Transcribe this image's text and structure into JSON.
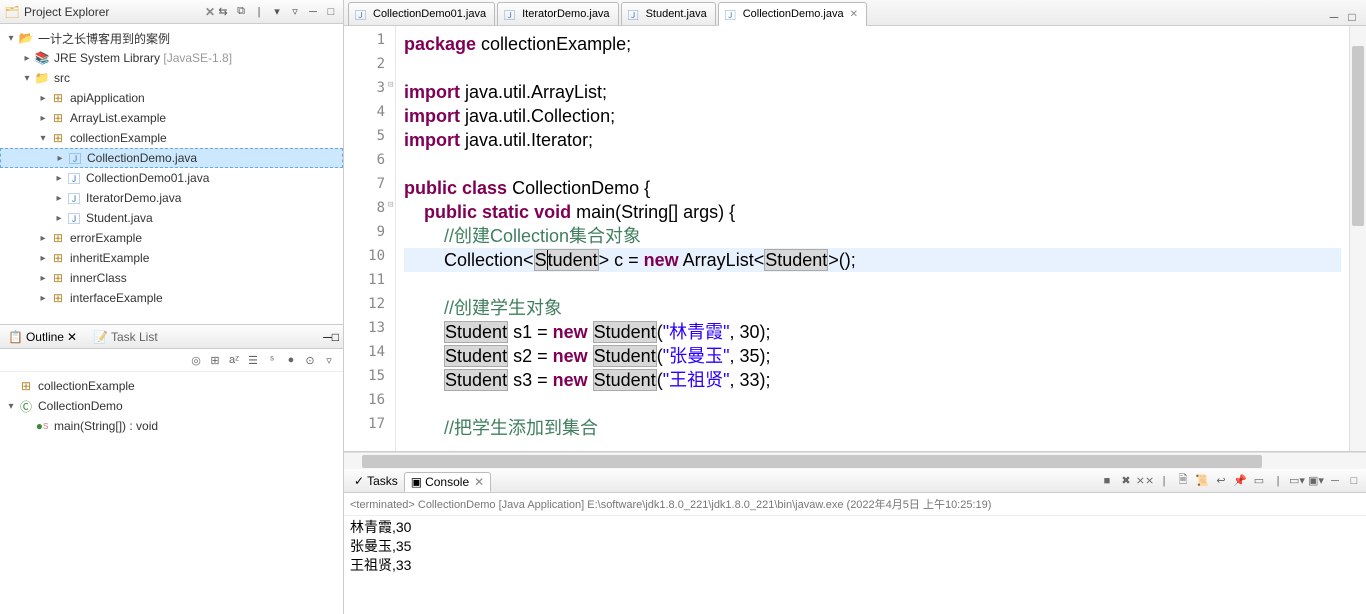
{
  "explorer": {
    "title": "Project Explorer",
    "items": [
      {
        "indent": 0,
        "arrow": "▾",
        "icon": "📂",
        "label": "一计之长博客用到的案例",
        "iconClass": "ic-folder",
        "expanded": true
      },
      {
        "indent": 1,
        "arrow": "▸",
        "icon": "📚",
        "label": "JRE System Library ",
        "suffix": "[JavaSE-1.8]",
        "iconClass": "ic-lib"
      },
      {
        "indent": 1,
        "arrow": "▾",
        "icon": "📁",
        "label": "src",
        "iconClass": "ic-pkg",
        "expanded": true
      },
      {
        "indent": 2,
        "arrow": "▸",
        "icon": "⊞",
        "label": "apiApplication",
        "iconClass": "ic-pkg"
      },
      {
        "indent": 2,
        "arrow": "▸",
        "icon": "⊞",
        "label": "ArrayList.example",
        "iconClass": "ic-pkg"
      },
      {
        "indent": 2,
        "arrow": "▾",
        "icon": "⊞",
        "label": "collectionExample",
        "iconClass": "ic-pkg",
        "expanded": true
      },
      {
        "indent": 3,
        "arrow": "▸",
        "icon": "🄹",
        "label": "CollectionDemo.java",
        "iconClass": "ic-java",
        "selected": true
      },
      {
        "indent": 3,
        "arrow": "▸",
        "icon": "🄹",
        "label": "CollectionDemo01.java",
        "iconClass": "ic-java"
      },
      {
        "indent": 3,
        "arrow": "▸",
        "icon": "🄹",
        "label": "IteratorDemo.java",
        "iconClass": "ic-java"
      },
      {
        "indent": 3,
        "arrow": "▸",
        "icon": "🄹",
        "label": "Student.java",
        "iconClass": "ic-java"
      },
      {
        "indent": 2,
        "arrow": "▸",
        "icon": "⊞",
        "label": "errorExample",
        "iconClass": "ic-pkg"
      },
      {
        "indent": 2,
        "arrow": "▸",
        "icon": "⊞",
        "label": "inheritExample",
        "iconClass": "ic-pkg"
      },
      {
        "indent": 2,
        "arrow": "▸",
        "icon": "⊞",
        "label": "innerClass",
        "iconClass": "ic-pkg"
      },
      {
        "indent": 2,
        "arrow": "▸",
        "icon": "⊞",
        "label": "interfaceExample",
        "iconClass": "ic-pkg"
      }
    ]
  },
  "outline": {
    "tab1": "Outline",
    "tab2": "Task List",
    "items": [
      {
        "indent": 0,
        "arrow": "",
        "icon": "⊞",
        "label": "collectionExample",
        "iconClass": "ic-pkg"
      },
      {
        "indent": 0,
        "arrow": "▾",
        "icon": "Ⓒ",
        "label": "CollectionDemo",
        "iconClass": "ic-class"
      },
      {
        "indent": 1,
        "arrow": "",
        "icon": "●",
        "label": "main(String[]) : void",
        "iconClass": "ic-method",
        "sup": "S"
      }
    ]
  },
  "tabs": [
    {
      "label": "CollectionDemo01.java",
      "active": false
    },
    {
      "label": "IteratorDemo.java",
      "active": false
    },
    {
      "label": "Student.java",
      "active": false
    },
    {
      "label": "CollectionDemo.java",
      "active": true
    }
  ],
  "code": {
    "lines": [
      {
        "n": 1,
        "html": "<span class='kw'>package</span> collectionExample;"
      },
      {
        "n": 2,
        "html": ""
      },
      {
        "n": 3,
        "fold": true,
        "html": "<span class='kw'>import</span> java.util.ArrayList;"
      },
      {
        "n": 4,
        "html": "<span class='kw'>import</span> java.util.Collection;"
      },
      {
        "n": 5,
        "html": "<span class='kw'>import</span> java.util.Iterator;"
      },
      {
        "n": 6,
        "html": ""
      },
      {
        "n": 7,
        "html": "<span class='kw'>public</span> <span class='kw'>class</span> CollectionDemo {"
      },
      {
        "n": 8,
        "fold": true,
        "html": "    <span class='kw'>public</span> <span class='kw'>static</span> <span class='kw'>void</span> main(String[] args) {"
      },
      {
        "n": 9,
        "html": "        <span class='cm'>//创建Collection集合对象</span>"
      },
      {
        "n": 10,
        "hl": true,
        "html": "        Collection&lt;<span class='match'>S<span class='cursor'></span>tudent</span>&gt; c = <span class='kw'>new</span> ArrayList&lt;<span class='match'>Student</span>&gt;();"
      },
      {
        "n": 11,
        "html": ""
      },
      {
        "n": 12,
        "html": "        <span class='cm'>//创建学生对象</span>"
      },
      {
        "n": 13,
        "html": "        <span class='match'>Student</span> s1 = <span class='kw'>new</span> <span class='match'>Student</span>(<span class='str'>\"林青霞\"</span>, 30);"
      },
      {
        "n": 14,
        "html": "        <span class='match'>Student</span> s2 = <span class='kw'>new</span> <span class='match'>Student</span>(<span class='str'>\"张曼玉\"</span>, 35);"
      },
      {
        "n": 15,
        "html": "        <span class='match'>Student</span> s3 = <span class='kw'>new</span> <span class='match'>Student</span>(<span class='str'>\"王祖贤\"</span>, 33);"
      },
      {
        "n": 16,
        "html": ""
      },
      {
        "n": 17,
        "html": "        <span class='cm'>//把学生添加到集合</span>"
      }
    ]
  },
  "console": {
    "tab1": "Tasks",
    "tab2": "Console",
    "info": "<terminated> CollectionDemo [Java Application] E:\\software\\jdk1.8.0_221\\jdk1.8.0_221\\bin\\javaw.exe (2022年4月5日 上午10:25:19)",
    "out": [
      "林青霞,30",
      "张曼玉,35",
      "王祖贤,33"
    ]
  }
}
